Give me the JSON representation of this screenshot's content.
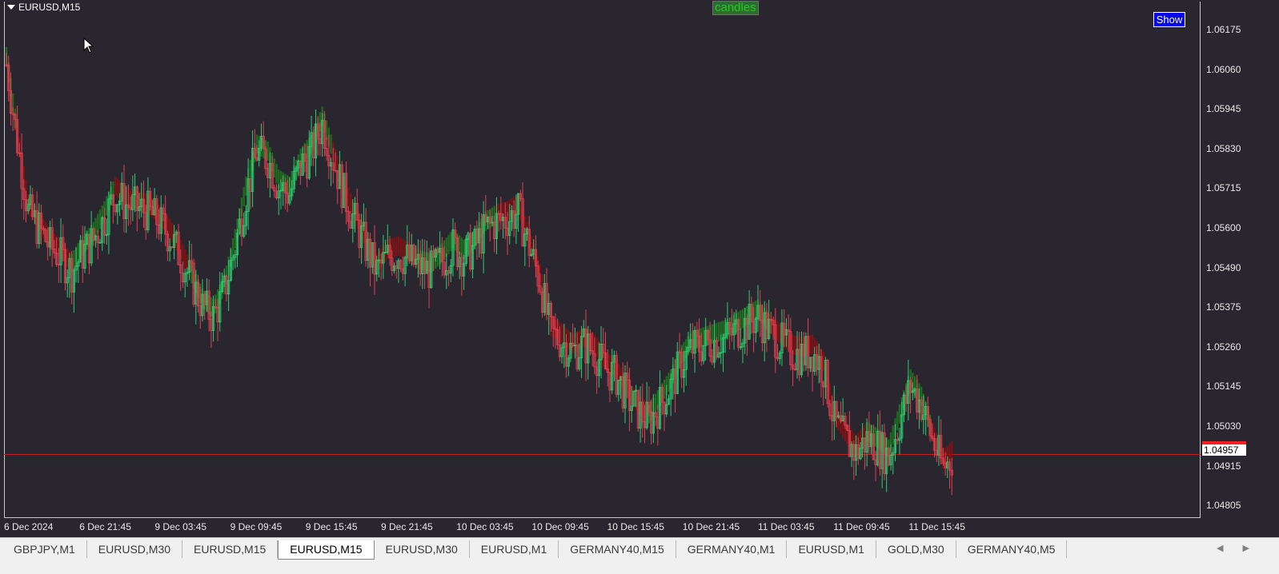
{
  "window": {
    "symbol_title": "EURUSD,M15",
    "indicator_label": "candles",
    "show_button": "Show"
  },
  "price_axis": {
    "labels": [
      "1.06175",
      "1.06060",
      "1.05945",
      "1.05830",
      "1.05715",
      "1.05600",
      "1.05490",
      "1.05375",
      "1.05260",
      "1.05145",
      "1.05030",
      "1.04915",
      "1.04805"
    ],
    "current_price": "1.04957",
    "current_price_color": "#ff2020"
  },
  "time_axis": {
    "labels": [
      "6 Dec 2024",
      "6 Dec 21:45",
      "9 Dec 03:45",
      "9 Dec 09:45",
      "9 Dec 15:45",
      "9 Dec 21:45",
      "10 Dec 03:45",
      "10 Dec 09:45",
      "10 Dec 15:45",
      "10 Dec 21:45",
      "11 Dec 03:45",
      "11 Dec 09:45",
      "11 Dec 15:45"
    ]
  },
  "colors": {
    "background": "#2a2630",
    "bull_candle": "#2ecc71",
    "bear_candle": "#e04050",
    "trend_up": "#1f7a1f",
    "trend_down": "#8b1010",
    "price_line": "#c02020"
  },
  "chart_data": {
    "type": "candlestick",
    "title": "",
    "ylim": [
      1.0478,
      1.0625
    ],
    "closes": [
      1.0607,
      1.0585,
      1.0565,
      1.056,
      1.0555,
      1.0552,
      1.0548,
      1.0553,
      1.0557,
      1.0563,
      1.057,
      1.0567,
      1.0566,
      1.0565,
      1.0562,
      1.0558,
      1.0552,
      1.0545,
      1.0538,
      1.0535,
      1.0542,
      1.0555,
      1.057,
      1.0582,
      1.058,
      1.0572,
      1.057,
      1.0578,
      1.0582,
      1.059,
      1.058,
      1.057,
      1.0562,
      1.0555,
      1.0548,
      1.0552,
      1.0553,
      1.0551,
      1.0549,
      1.0548,
      1.0551,
      1.0555,
      1.0552,
      1.0555,
      1.056,
      1.0562,
      1.0563,
      1.0565,
      1.0555,
      1.0545,
      1.053,
      1.0528,
      1.0525,
      1.0527,
      1.0525,
      1.052,
      1.0518,
      1.0512,
      1.0508,
      1.0505,
      1.051,
      1.0515,
      1.0522,
      1.0526,
      1.0527,
      1.0528,
      1.0529,
      1.0531,
      1.0533,
      1.0535,
      1.0531,
      1.0528,
      1.0525,
      1.0524,
      1.0525,
      1.052,
      1.0505,
      1.05,
      1.0496,
      1.05,
      1.0498,
      1.0495,
      1.0505,
      1.0515,
      1.051,
      1.05,
      1.0492,
      1.0495
    ],
    "trend": [
      "up",
      "down",
      "down",
      "down",
      "down",
      "down",
      "up",
      "up",
      "up",
      "up",
      "down",
      "down",
      "down",
      "down",
      "down",
      "down",
      "down",
      "up",
      "up",
      "up",
      "up",
      "up",
      "up",
      "up",
      "up",
      "up",
      "up",
      "up",
      "up",
      "up",
      "down",
      "down",
      "down",
      "down",
      "down",
      "down",
      "down",
      "down",
      "up",
      "up",
      "up",
      "up",
      "up",
      "up",
      "up",
      "down",
      "down",
      "down",
      "down",
      "down",
      "down",
      "down",
      "down",
      "down",
      "down",
      "down",
      "down",
      "down",
      "down",
      "up",
      "up",
      "up",
      "up",
      "up",
      "up",
      "up",
      "up",
      "up",
      "up",
      "up",
      "down",
      "down",
      "down",
      "down",
      "down",
      "down",
      "down",
      "down",
      "down",
      "up",
      "up",
      "up",
      "up",
      "up",
      "up",
      "down",
      "down",
      "down"
    ]
  }
}
